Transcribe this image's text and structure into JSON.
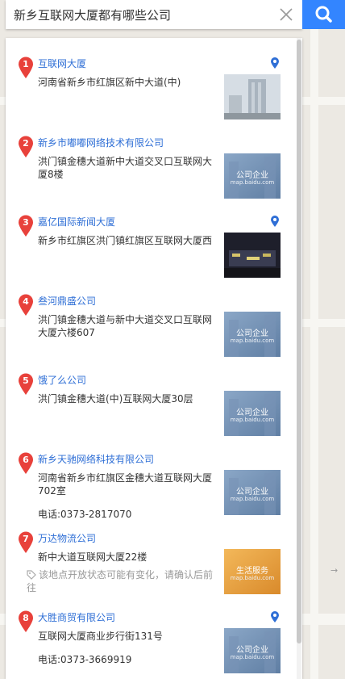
{
  "search": {
    "value": "新乡互联网大厦都有哪些公司",
    "clear_icon": "close-icon",
    "search_icon": "search-icon",
    "button_color": "#3385ff"
  },
  "accent_color": "#2f6fd6",
  "pin_color": "#e8413b",
  "results": [
    {
      "index": "1",
      "name": "互联网大厦",
      "address": "河南省新乡市红旗区新中大道(中)",
      "thumbnail": "photo-building"
    },
    {
      "index": "2",
      "name": "新乡市嘟嘟网络技术有限公司",
      "address": "洪门镇金穗大道新中大道交叉口互联网大厦8楼",
      "thumbnail": "placeholder-company",
      "thumb_label": "公司企业",
      "thumb_sub": "map.baidu.com"
    },
    {
      "index": "3",
      "name": "嘉亿国际新闻大厦",
      "address": "新乡市红旗区洪门镇红旗区互联网大厦西",
      "thumbnail": "photo-night"
    },
    {
      "index": "4",
      "name": "叁河鼎盛公司",
      "address": "洪门镇金穗大道与新中大道交叉口互联网大厦六楼607",
      "thumbnail": "placeholder-company",
      "thumb_label": "公司企业",
      "thumb_sub": "map.baidu.com"
    },
    {
      "index": "5",
      "name": "饿了么公司",
      "address": "洪门镇金穗大道(中)互联网大厦30层",
      "thumbnail": "placeholder-company",
      "thumb_label": "公司企业",
      "thumb_sub": "map.baidu.com"
    },
    {
      "index": "6",
      "name": "新乡天驰网络科技有限公司",
      "address": "河南省新乡市红旗区金穗大道互联网大厦702室",
      "phone": "电话:0373-2817070",
      "thumbnail": "placeholder-company",
      "thumb_label": "公司企业",
      "thumb_sub": "map.baidu.com"
    },
    {
      "index": "7",
      "name": "万达物流公司",
      "address": "新中大道互联网大厦22楼",
      "note": "该地点开放状态可能有变化，请确认后前往",
      "thumbnail": "placeholder-life",
      "thumb_label": "生活服务",
      "thumb_sub": "map.baidu.com"
    },
    {
      "index": "8",
      "name": "大胜商贸有限公司",
      "address": "互联网大厦商业步行街131号",
      "phone": "电话:0373-3669919",
      "thumbnail": "placeholder-company",
      "thumb_label": "公司企业",
      "thumb_sub": "map.baidu.com"
    }
  ]
}
